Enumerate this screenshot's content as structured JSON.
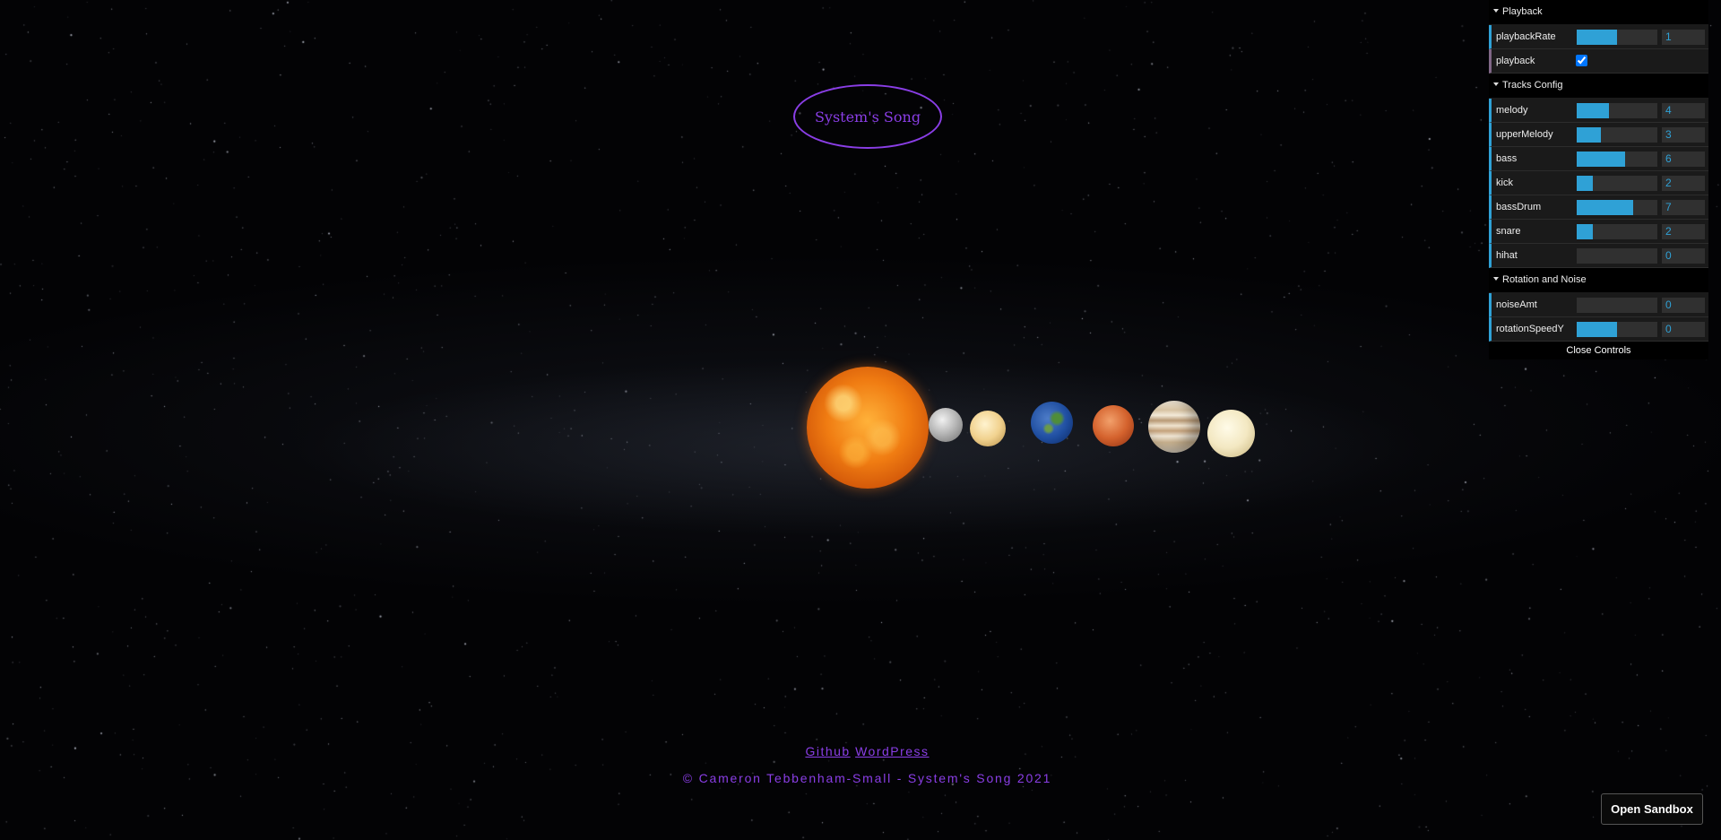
{
  "title": "System's Song",
  "gui": {
    "folders": [
      {
        "title": "Playback",
        "controls": [
          {
            "label": "playbackRate",
            "type": "slider",
            "value": "1",
            "fill": 0.5
          },
          {
            "label": "playback",
            "type": "checkbox",
            "checked": true
          }
        ]
      },
      {
        "title": "Tracks Config",
        "controls": [
          {
            "label": "melody",
            "type": "slider",
            "value": "4",
            "fill": 0.4
          },
          {
            "label": "upperMelody",
            "type": "slider",
            "value": "3",
            "fill": 0.3
          },
          {
            "label": "bass",
            "type": "slider",
            "value": "6",
            "fill": 0.6
          },
          {
            "label": "kick",
            "type": "slider",
            "value": "2",
            "fill": 0.2
          },
          {
            "label": "bassDrum",
            "type": "slider",
            "value": "7",
            "fill": 0.7
          },
          {
            "label": "snare",
            "type": "slider",
            "value": "2",
            "fill": 0.2
          },
          {
            "label": "hihat",
            "type": "slider",
            "value": "0",
            "fill": 0
          }
        ]
      },
      {
        "title": "Rotation and Noise",
        "controls": [
          {
            "label": "noiseAmt",
            "type": "slider",
            "value": "0",
            "fill": 0
          },
          {
            "label": "rotationSpeedY",
            "type": "slider",
            "value": "0",
            "fill": 0.5
          }
        ]
      }
    ],
    "close_label": "Close Controls"
  },
  "planets": [
    "sun",
    "mercury",
    "venus",
    "earth",
    "mars",
    "jupiter",
    "saturn"
  ],
  "footer": {
    "links": [
      "Github",
      "WordPress"
    ],
    "copyright": "© Cameron Tebbenham-Small - System's Song 2021"
  },
  "sandbox_button": "Open Sandbox",
  "colors": {
    "accent": "#8a3ee6",
    "slider": "#2fa1d6",
    "background": "#000000"
  }
}
